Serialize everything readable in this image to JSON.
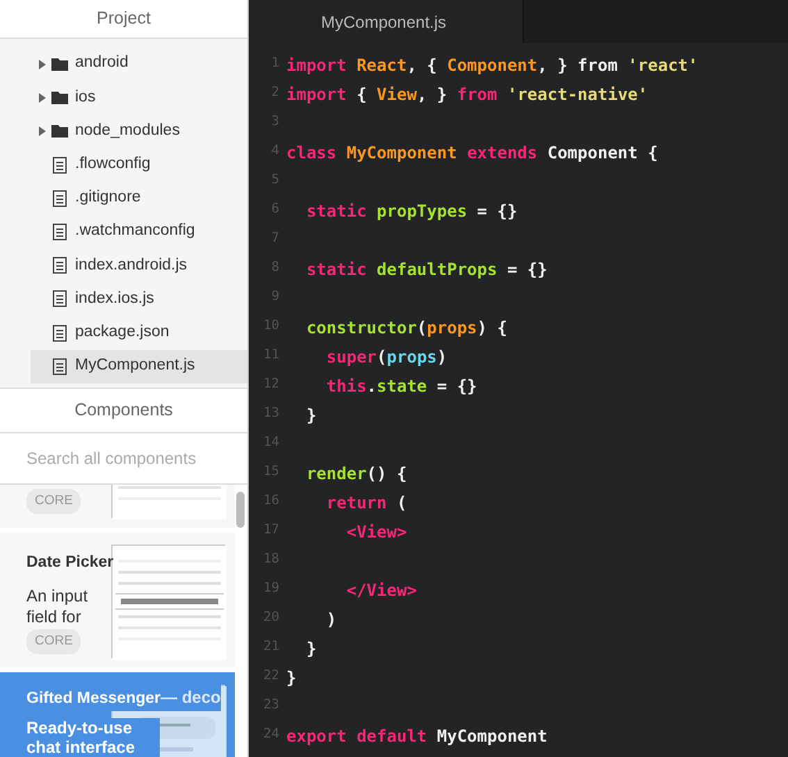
{
  "sidebar": {
    "project": {
      "title": "Project",
      "tree": [
        {
          "name": "android",
          "kind": "folder",
          "expanded": false,
          "selected": false
        },
        {
          "name": "ios",
          "kind": "folder",
          "expanded": false,
          "selected": false
        },
        {
          "name": "node_modules",
          "kind": "folder",
          "expanded": false,
          "selected": false
        },
        {
          "name": ".flowconfig",
          "kind": "file",
          "selected": false
        },
        {
          "name": ".gitignore",
          "kind": "file",
          "selected": false
        },
        {
          "name": ".watchmanconfig",
          "kind": "file",
          "selected": false
        },
        {
          "name": "index.android.js",
          "kind": "file",
          "selected": false
        },
        {
          "name": "index.ios.js",
          "kind": "file",
          "selected": false
        },
        {
          "name": "package.json",
          "kind": "file",
          "selected": false
        },
        {
          "name": "MyComponent.js",
          "kind": "file",
          "selected": true
        }
      ]
    },
    "components": {
      "title": "Components",
      "search": {
        "placeholder": "Search all components"
      },
      "cards": [
        {
          "tag": "CORE",
          "selected": false
        },
        {
          "title": "Date Picker",
          "description": "An input field for",
          "tag": "CORE",
          "selected": false
        },
        {
          "title": "Gifted Messenger",
          "source": "— deco",
          "description": "Ready-to-use chat interface",
          "selected": true
        }
      ]
    }
  },
  "editor": {
    "tabs": [
      {
        "label": "MyComponent.js",
        "selected": true
      }
    ],
    "lines": [
      {
        "number": "1",
        "tokens": [
          {
            "t": "import ",
            "kind": "kw"
          },
          {
            "t": "React",
            "kind": "type"
          },
          {
            "t": ", { ",
            "kind": "plain"
          },
          {
            "t": "Component",
            "kind": "type"
          },
          {
            "t": ", } from ",
            "kind": "plain"
          },
          {
            "t": "'react'",
            "kind": "str"
          }
        ]
      },
      {
        "number": "2",
        "tokens": [
          {
            "t": "import",
            "kind": "kw"
          },
          {
            "t": " { ",
            "kind": "plain"
          },
          {
            "t": "View",
            "kind": "type"
          },
          {
            "t": ", } ",
            "kind": "plain"
          },
          {
            "t": "from ",
            "kind": "kw"
          },
          {
            "t": "'react-native'",
            "kind": "str"
          }
        ]
      },
      {
        "number": "3"
      },
      {
        "number": "4",
        "tokens": [
          {
            "t": "class ",
            "kind": "kw"
          },
          {
            "t": "MyComponent ",
            "kind": "type"
          },
          {
            "t": "extends ",
            "kind": "kw"
          },
          {
            "t": "Component {",
            "kind": "plain"
          }
        ]
      },
      {
        "number": "5"
      },
      {
        "number": "6",
        "tokens": [
          {
            "t": "  static ",
            "kind": "kw"
          },
          {
            "t": "propTypes",
            "kind": "fn"
          },
          {
            "t": " = {}",
            "kind": "plain"
          }
        ]
      },
      {
        "number": "7"
      },
      {
        "number": "8",
        "tokens": [
          {
            "t": "  static ",
            "kind": "kw"
          },
          {
            "t": "defaultProps",
            "kind": "fn"
          },
          {
            "t": " = {}",
            "kind": "plain"
          }
        ]
      },
      {
        "number": "9"
      },
      {
        "number": "10",
        "tokens": [
          {
            "t": "  constructor",
            "kind": "fn"
          },
          {
            "t": "(",
            "kind": "plain"
          },
          {
            "t": "props",
            "kind": "type"
          },
          {
            "t": ") {",
            "kind": "plain"
          }
        ]
      },
      {
        "number": "11",
        "tokens": [
          {
            "t": "    super",
            "kind": "kw"
          },
          {
            "t": "(",
            "kind": "plain"
          },
          {
            "t": "props",
            "kind": "var"
          },
          {
            "t": ")",
            "kind": "plain"
          }
        ]
      },
      {
        "number": "12",
        "tokens": [
          {
            "t": "    this",
            "kind": "kw"
          },
          {
            "t": ".",
            "kind": "plain"
          },
          {
            "t": "state",
            "kind": "fn"
          },
          {
            "t": " = {}",
            "kind": "plain"
          }
        ]
      },
      {
        "number": "13",
        "tokens": [
          {
            "t": "  }",
            "kind": "plain"
          }
        ]
      },
      {
        "number": "14"
      },
      {
        "number": "15",
        "tokens": [
          {
            "t": "  render",
            "kind": "fn"
          },
          {
            "t": "() {",
            "kind": "plain"
          }
        ]
      },
      {
        "number": "16",
        "tokens": [
          {
            "t": "    return",
            "kind": "kw"
          },
          {
            "t": " (",
            "kind": "plain"
          }
        ]
      },
      {
        "number": "17",
        "tokens": [
          {
            "t": "      <View>",
            "kind": "kw"
          }
        ]
      },
      {
        "number": "18"
      },
      {
        "number": "19",
        "tokens": [
          {
            "t": "      </View>",
            "kind": "kw"
          }
        ]
      },
      {
        "number": "20",
        "tokens": [
          {
            "t": "    )",
            "kind": "plain"
          }
        ]
      },
      {
        "number": "21",
        "tokens": [
          {
            "t": "  }",
            "kind": "plain"
          }
        ]
      },
      {
        "number": "22",
        "tokens": [
          {
            "t": "}",
            "kind": "plain"
          }
        ]
      },
      {
        "number": "23"
      },
      {
        "number": "24",
        "tokens": [
          {
            "t": "export ",
            "kind": "kw"
          },
          {
            "t": "default",
            "kind": "kw"
          },
          {
            "t": " MyComponent",
            "kind": "plain"
          }
        ]
      }
    ]
  }
}
